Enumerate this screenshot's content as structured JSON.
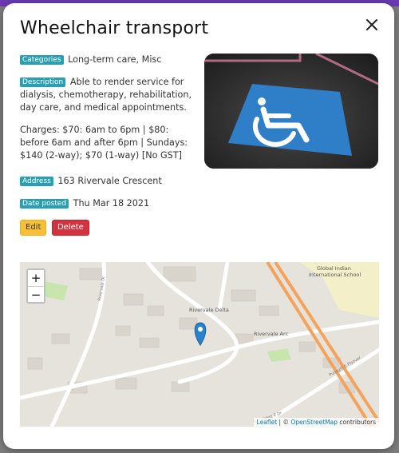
{
  "modal": {
    "title": "Wheelchair transport",
    "close_icon": "close-icon"
  },
  "details": {
    "categories_label": "Categories",
    "categories_value": "Long-term care, Misc",
    "description_label": "Description",
    "description_value": "Able to render service for dialysis, chemotherapy, rehabilitation, day care, and medical appointments.",
    "charges": "Charges: $70: 6am to 6pm | $80: before 6am and after 6pm | Sundays: $140 (2-way); $70 (1-way) [No GST]",
    "address_label": "Address",
    "address_value": "163 Rivervale Crescent",
    "date_label": "Date posted",
    "date_value": "Thu Mar 18 2021"
  },
  "actions": {
    "edit_label": "Edit",
    "delete_label": "Delete"
  },
  "map": {
    "zoom_in": "+",
    "zoom_out": "−",
    "labels": {
      "rivervale_delta": "Rivervale Delta",
      "rivervale_arc": "Rivervale Arc",
      "global_indian": "Global Indian",
      "international_school": "International School",
      "rivervale_dr": "Rivervale Dr",
      "sengkang_east_dr": "Sengkang E Dr",
      "punggol_flyover": "Punggol E Flyover"
    },
    "attribution_leaflet": "Leaflet",
    "attribution_sep": " | © ",
    "attribution_osm": "OpenStreetMap",
    "attribution_tail": " contributors"
  },
  "colors": {
    "badge": "#2a9fb3",
    "edit": "#f7c036",
    "delete": "#d2333f",
    "marker": "#2a82cb",
    "highway": "#f3a35c"
  }
}
